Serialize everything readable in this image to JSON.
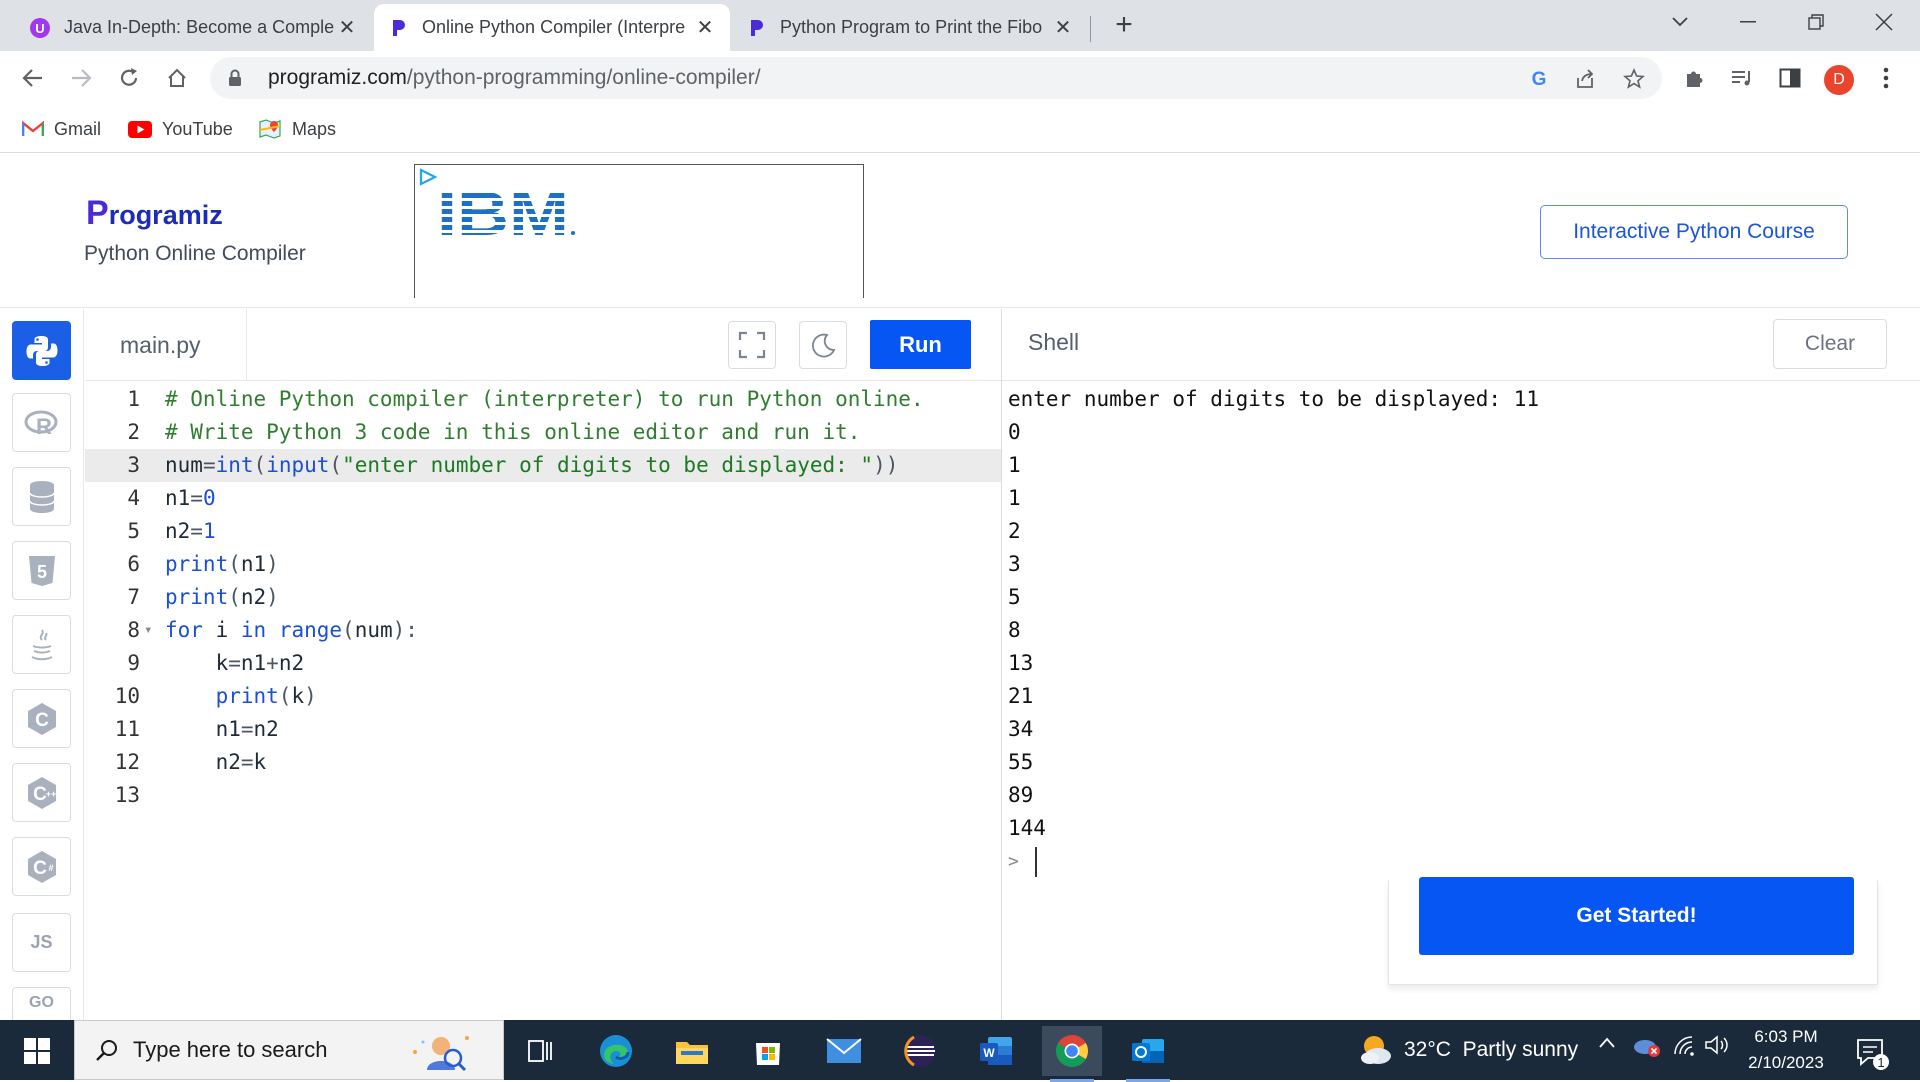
{
  "browser": {
    "tabs": [
      {
        "title": "Java In-Depth: Become a Comple",
        "active": false
      },
      {
        "title": "Online Python Compiler (Interpre",
        "active": true
      },
      {
        "title": "Python Program to Print the Fibo",
        "active": false
      }
    ],
    "new_tab_label": "+",
    "url_host": "programiz.com",
    "url_path": "/python-programming/online-compiler/",
    "avatar_letter": "D",
    "bookmarks": [
      {
        "label": "Gmail"
      },
      {
        "label": "YouTube"
      },
      {
        "label": "Maps"
      }
    ]
  },
  "header": {
    "logo_text": "rogramiz",
    "logo_initial": "P",
    "subtitle": "Python Online Compiler",
    "ad_brand": "IBM",
    "course_button": "Interactive Python Course"
  },
  "sidebar": {
    "languages": [
      {
        "name": "python",
        "active": true
      },
      {
        "name": "r",
        "active": false
      },
      {
        "name": "sql",
        "active": false
      },
      {
        "name": "html",
        "active": false
      },
      {
        "name": "java",
        "active": false
      },
      {
        "name": "c",
        "active": false
      },
      {
        "name": "cpp",
        "active": false
      },
      {
        "name": "csharp",
        "active": false
      },
      {
        "name": "js",
        "label": "JS",
        "active": false
      },
      {
        "name": "go",
        "label": "GO",
        "active": false
      }
    ]
  },
  "editor": {
    "filename": "main.py",
    "run_label": "Run",
    "active_line": 3,
    "lines": [
      {
        "n": "1",
        "text": "# Online Python compiler (interpreter) to run Python online."
      },
      {
        "n": "2",
        "text": "# Write Python 3 code in this online editor and run it."
      },
      {
        "n": "3",
        "text": "num=int(input(\"enter number of digits to be displayed: \"))"
      },
      {
        "n": "4",
        "text": "n1=0"
      },
      {
        "n": "5",
        "text": "n2=1"
      },
      {
        "n": "6",
        "text": "print(n1)"
      },
      {
        "n": "7",
        "text": "print(n2)"
      },
      {
        "n": "8",
        "text": "for i in range(num):"
      },
      {
        "n": "9",
        "text": "    k=n1+n2"
      },
      {
        "n": "10",
        "text": "    print(k)"
      },
      {
        "n": "11",
        "text": "    n1=n2"
      },
      {
        "n": "12",
        "text": "    n2=k"
      },
      {
        "n": "13",
        "text": ""
      }
    ]
  },
  "shell": {
    "label": "Shell",
    "clear_label": "Clear",
    "output": [
      "enter number of digits to be displayed: 11",
      "0",
      "1",
      "1",
      "2",
      "3",
      "5",
      "8",
      "13",
      "21",
      "34",
      "55",
      "89",
      "144"
    ],
    "prompt": ">",
    "get_started": "Get Started!"
  },
  "taskbar": {
    "search_placeholder": "Type here to search",
    "weather": "32°C  Partly sunny",
    "time": "6:03 PM",
    "date": "2/10/2023",
    "notification_count": "1"
  }
}
